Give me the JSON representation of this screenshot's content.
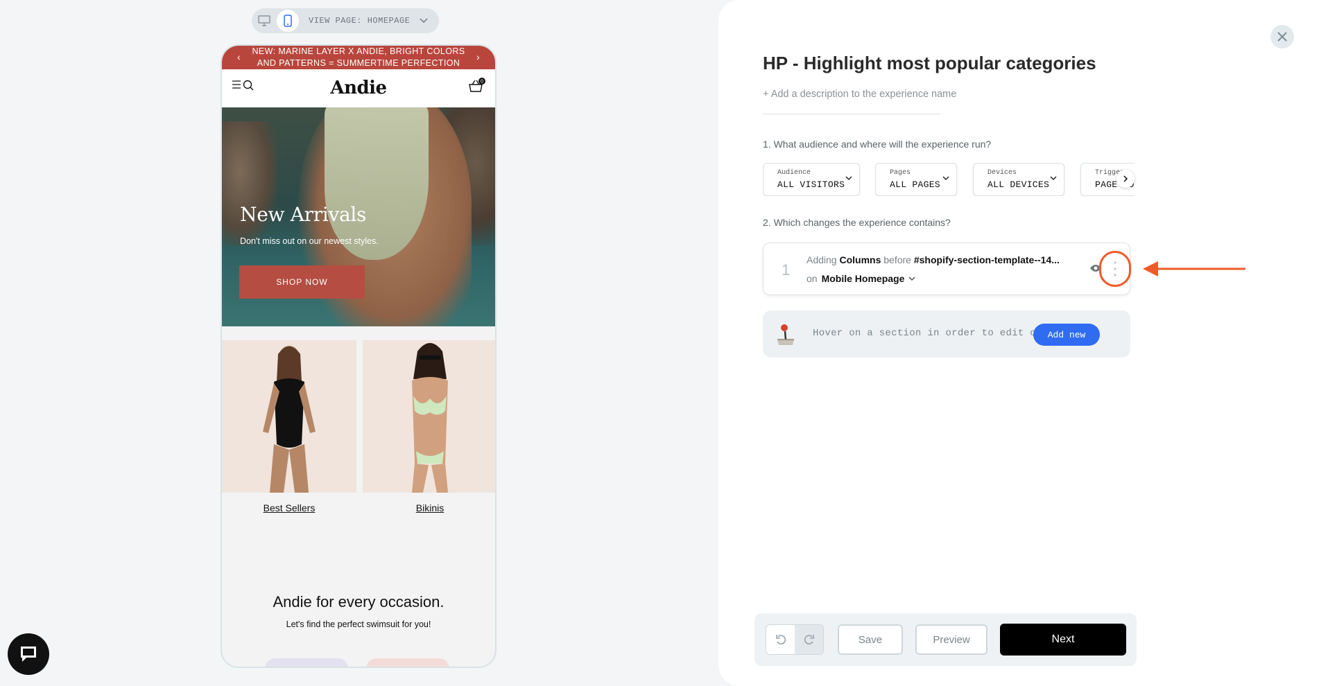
{
  "viewbar": {
    "label": "VIEW PAGE: HOMEPAGE",
    "devices": [
      "desktop-icon",
      "mobile-icon"
    ]
  },
  "site": {
    "promo": "NEW: MARINE LAYER X ANDIE, BRIGHT COLORS AND PATTERNS = SUMMERTIME PERFECTION",
    "logo": "Andie",
    "cart_count": "0",
    "hero": {
      "title": "New Arrivals",
      "subtitle": "Don't miss out on our newest styles.",
      "cta": "SHOP NOW"
    },
    "categories": [
      {
        "label": "Best Sellers"
      },
      {
        "label": "Bikinis"
      }
    ],
    "occasion": {
      "title": "Andie for every occasion.",
      "subtitle": "Let's find the perfect swimsuit for you!"
    }
  },
  "panel": {
    "title": "HP - Highlight most popular categories",
    "description_placeholder": "+ Add a description to the experience name",
    "question1": "1. What audience and where will the experience run?",
    "question2": "2. Which changes the experience contains?",
    "chips": [
      {
        "key": "Audience",
        "value": "ALL VISITORS"
      },
      {
        "key": "Pages",
        "value": "ALL PAGES"
      },
      {
        "key": "Devices",
        "value": "ALL DEVICES"
      },
      {
        "key": "Trigger",
        "value": "PAGE LOAD"
      }
    ],
    "change": {
      "number": "1",
      "verb": "Adding",
      "element": "Columns",
      "position": "before",
      "selector": "#shopify-section-template--14...",
      "on_label": "on",
      "page": "Mobile Homepage"
    },
    "hover_text": "Hover on a section in order to edit or",
    "add_new": "Add new",
    "footer": {
      "save": "Save",
      "preview": "Preview",
      "next": "Next"
    }
  },
  "colors": {
    "accent": "#2f6cf1",
    "highlight": "#f05a2a",
    "promo": "#b8463c"
  }
}
